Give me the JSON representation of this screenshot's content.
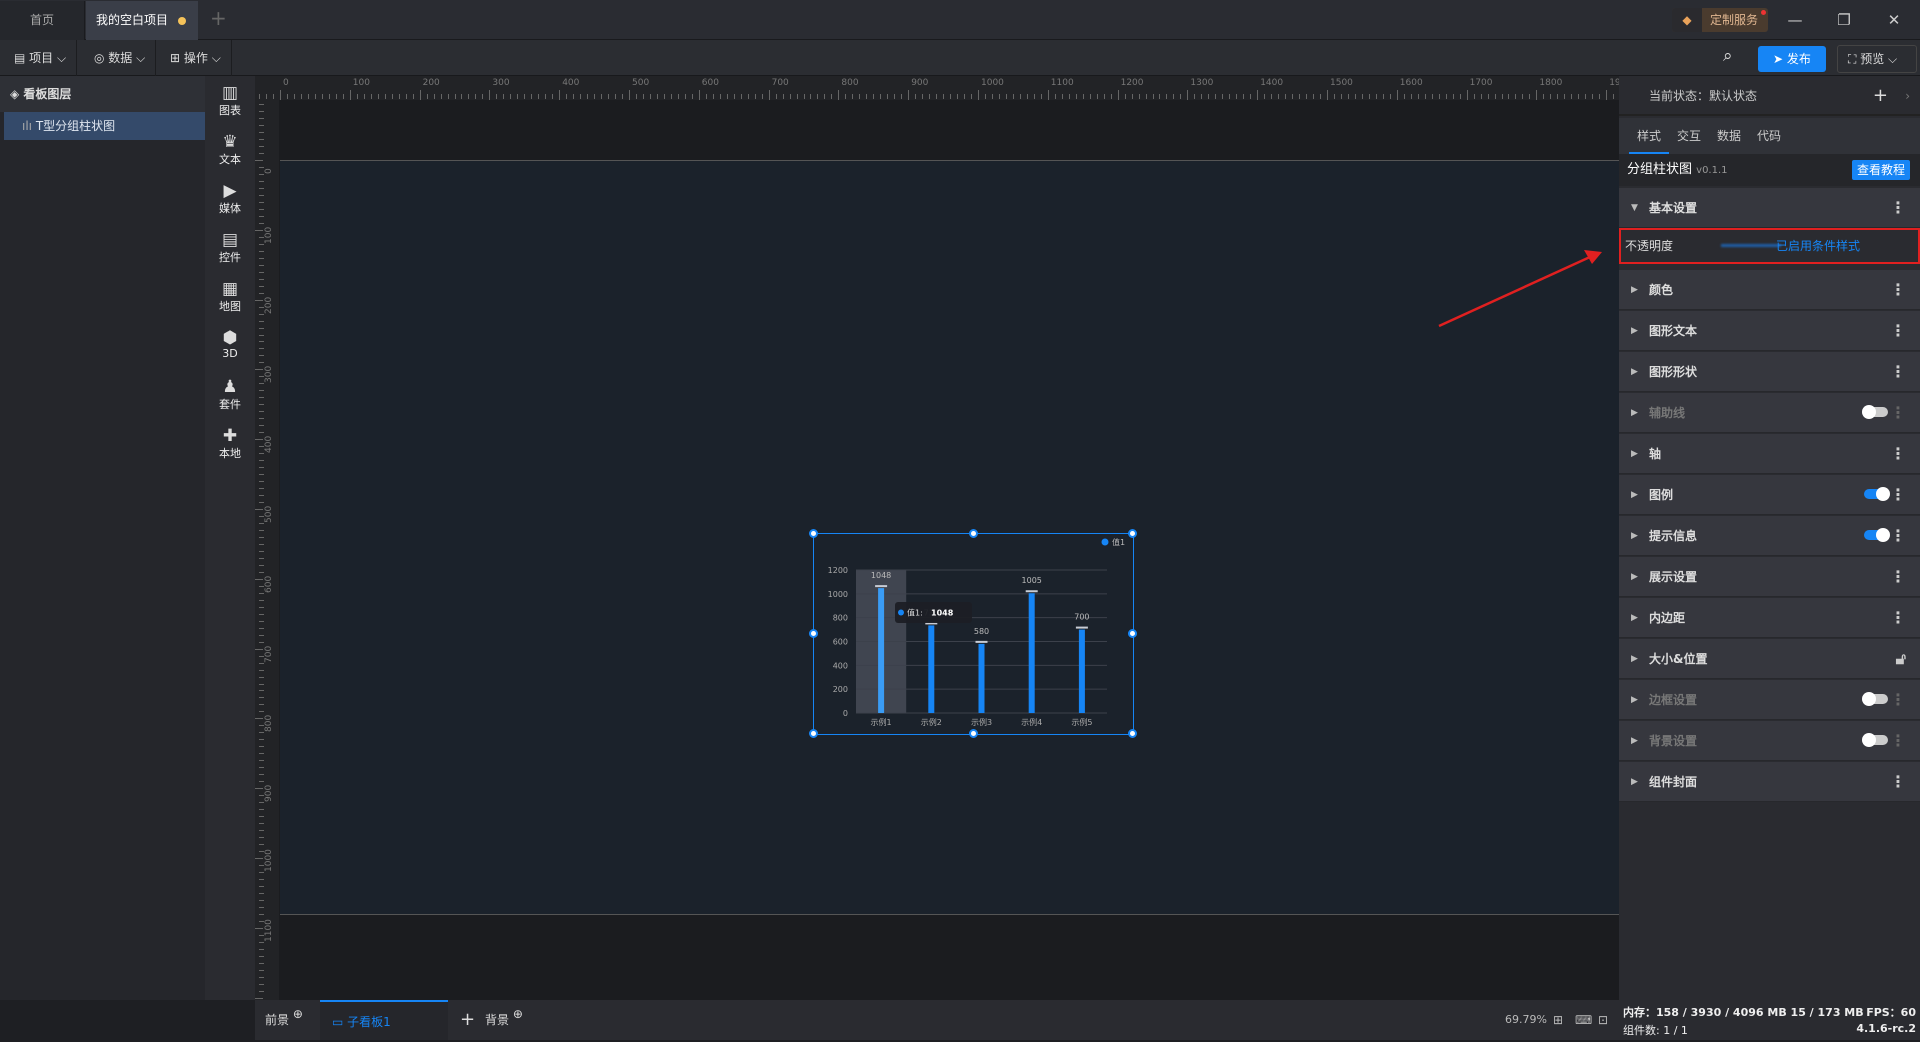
{
  "titlebar": {
    "tabs": [
      "首页",
      "我的空白项目"
    ],
    "add": "+",
    "custom_service": "定制服务",
    "minimize": "—",
    "restore": "❐",
    "close": "✕"
  },
  "toolbar": {
    "menus": [
      "项目",
      "数据",
      "操作"
    ],
    "publish": "发布",
    "preview": "预览"
  },
  "layers": {
    "title": "看板图层",
    "items": [
      "T型分组柱状图"
    ]
  },
  "components": [
    {
      "icon": "chart-icon",
      "label": "图表"
    },
    {
      "icon": "text-icon",
      "label": "文本"
    },
    {
      "icon": "media-icon",
      "label": "媒体"
    },
    {
      "icon": "control-icon",
      "label": "控件"
    },
    {
      "icon": "map-icon",
      "label": "地图"
    },
    {
      "icon": "cube-icon",
      "label": "3D"
    },
    {
      "icon": "kit-icon",
      "label": "套件"
    },
    {
      "icon": "puzzle-icon",
      "label": "本地"
    }
  ],
  "ruler": {
    "h": [
      "0",
      "100",
      "200",
      "300",
      "400",
      "500",
      "600",
      "700",
      "800",
      "900",
      "1000",
      "1100",
      "1200",
      "1300",
      "1400",
      "1500",
      "1600",
      "1700",
      "1800",
      "1900"
    ],
    "v": [
      "0",
      "100",
      "200",
      "300",
      "400",
      "500",
      "600",
      "700",
      "800",
      "900",
      "1000",
      "1100"
    ]
  },
  "chart_data": {
    "type": "bar",
    "categories": [
      "示例1",
      "示例2",
      "示例3",
      "示例4",
      "示例5"
    ],
    "series": [
      {
        "name": "值1",
        "values": [
          1048,
          735,
          580,
          1005,
          700
        ]
      }
    ],
    "ylim": [
      0,
      1200
    ],
    "yticks": [
      "0",
      "200",
      "400",
      "600",
      "800",
      "1000",
      "1200"
    ],
    "grid": true,
    "legend": "top-right",
    "color": "#1685f5",
    "tooltip": {
      "label": "值1:",
      "value": "1048"
    }
  },
  "bottom": {
    "foreground": "前景",
    "subboard": "子看板1",
    "add": "+",
    "background": "背景",
    "zoom": "69.79%"
  },
  "right": {
    "state": "当前状态：默认状态",
    "tabs": [
      "样式",
      "交互",
      "数据",
      "代码"
    ],
    "component": "分组柱状图",
    "version": "v0.1.1",
    "tutorial": "查看教程",
    "sections": [
      {
        "label": "基本设置",
        "open": true
      },
      {
        "label": "颜色"
      },
      {
        "label": "图形文本"
      },
      {
        "label": "图形形状"
      },
      {
        "label": "辅助线",
        "toggle": false,
        "disabled": true
      },
      {
        "label": "轴"
      },
      {
        "label": "图例",
        "toggle": true
      },
      {
        "label": "提示信息",
        "toggle": true
      },
      {
        "label": "展示设置"
      },
      {
        "label": "内边距"
      },
      {
        "label": "大小&位置",
        "lock": true
      },
      {
        "label": "边框设置",
        "toggle": false,
        "disabled": true
      },
      {
        "label": "背景设置",
        "toggle": false,
        "disabled": true
      },
      {
        "label": "组件封面"
      }
    ],
    "opacity_label": "不透明度",
    "opacity_status": "已启用条件样式"
  },
  "status": {
    "memory": "内存：158 / 3930 / 4096 MB  15 / 173 MB",
    "fps": "FPS：60",
    "count": "组件数: 1 / 1",
    "version": "4.1.6-rc.2"
  },
  "colors": {
    "accent": "#1685f5",
    "highlight": "#e02020"
  }
}
